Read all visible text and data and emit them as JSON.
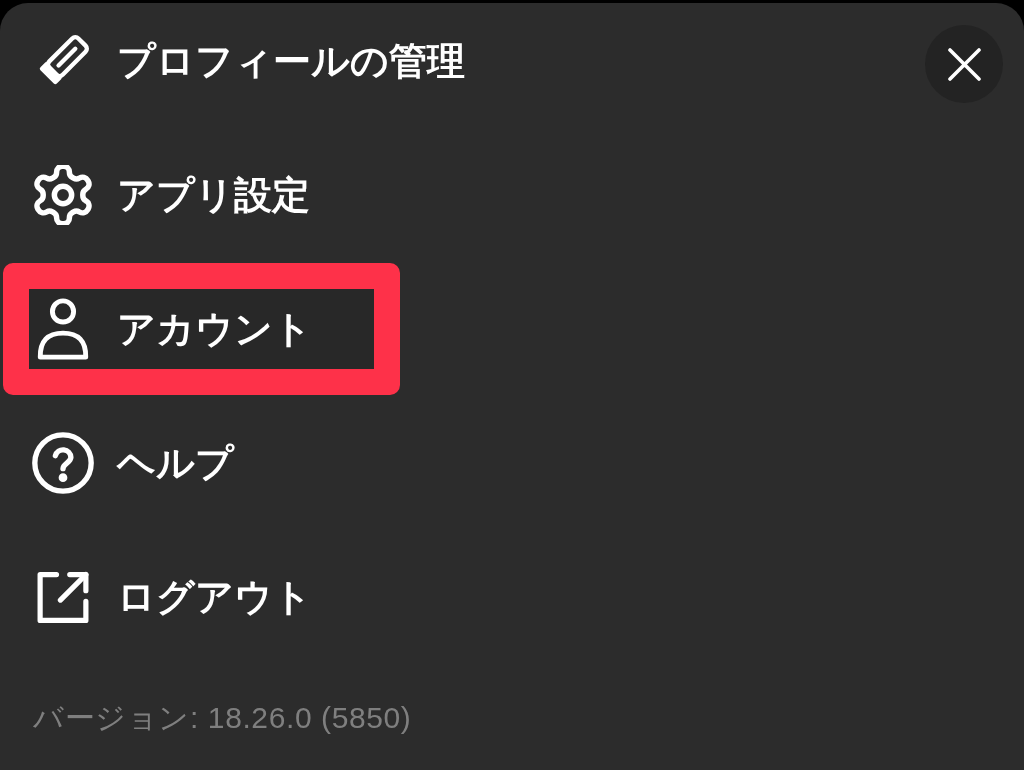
{
  "menu": {
    "items": [
      {
        "label": "プロフィールの管理",
        "highlighted": false
      },
      {
        "label": "アプリ設定",
        "highlighted": false
      },
      {
        "label": "アカウント",
        "highlighted": true
      },
      {
        "label": "ヘルプ",
        "highlighted": false
      },
      {
        "label": "ログアウト",
        "highlighted": false
      }
    ]
  },
  "version": "バージョン: 18.26.0 (5850)"
}
